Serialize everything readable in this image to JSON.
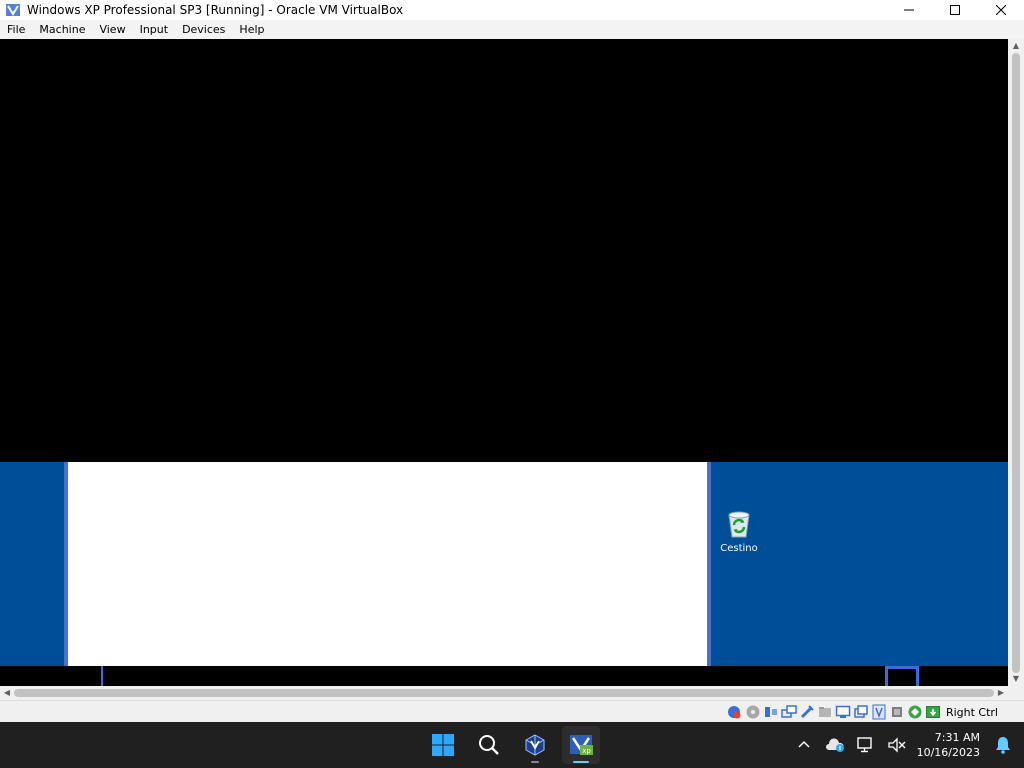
{
  "window": {
    "title": "Windows XP Professional SP3 [Running] - Oracle VM VirtualBox"
  },
  "menu": {
    "items": [
      "File",
      "Machine",
      "View",
      "Input",
      "Devices",
      "Help"
    ]
  },
  "vm": {
    "desktop_color": "#004e98",
    "recycle_bin_label": "Cestino"
  },
  "statusbar": {
    "host_key": "Right Ctrl",
    "icons": [
      "hard-disk-icon",
      "optical-drive-icon",
      "audio-icon",
      "network-icon",
      "usb-icon",
      "shared-folders-icon",
      "display-icon",
      "recording-icon",
      "virtualization-icon",
      "cpu-icon",
      "mouse-integration-icon",
      "keyboard-icon"
    ]
  },
  "taskbar": {
    "apps": [
      "windows-start-icon",
      "search-icon",
      "virtualbox-icon",
      "vm-xp-icon"
    ],
    "time": "7:31 AM",
    "date": "10/16/2023"
  }
}
